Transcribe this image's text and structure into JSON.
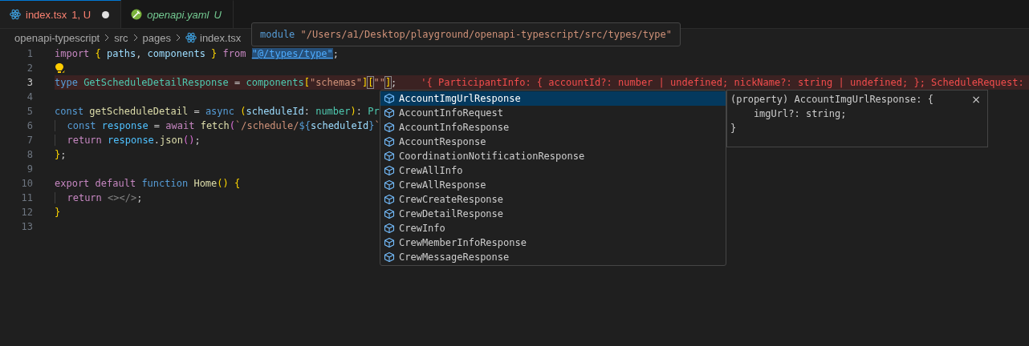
{
  "tabs": [
    {
      "label": "index.tsx",
      "badge": "1, U",
      "kind": "react",
      "selected": true,
      "modified": true,
      "preview": false
    },
    {
      "label": "openapi.yaml",
      "badge": "U",
      "kind": "yaml",
      "selected": false,
      "modified": false,
      "preview": true
    }
  ],
  "breadcrumbs": [
    {
      "label": "openapi-typescript",
      "kind": "folder"
    },
    {
      "label": "src",
      "kind": "folder"
    },
    {
      "label": "pages",
      "kind": "folder"
    },
    {
      "label": "index.tsx",
      "kind": "react"
    }
  ],
  "hover": {
    "tokens": [
      {
        "text": "module ",
        "kind": "kw"
      },
      {
        "text": "\"/Users/a1/Desktop/playground/openapi-typescript/src/types/type\"",
        "kind": "str"
      }
    ]
  },
  "lines": [
    {
      "number": "1",
      "tokens": [
        {
          "text": "import ",
          "kind": "ctrl"
        },
        {
          "text": "{ ",
          "kind": "brace"
        },
        {
          "text": "paths",
          "kind": "var"
        },
        {
          "text": ", ",
          "kind": "punct"
        },
        {
          "text": "components ",
          "kind": "var"
        },
        {
          "text": "} ",
          "kind": "brace"
        },
        {
          "text": "from ",
          "kind": "ctrl"
        },
        {
          "text": "\"@/types/type\"",
          "kind": "link"
        },
        {
          "text": ";",
          "kind": "punct"
        }
      ]
    },
    {
      "number": "2",
      "lightbulb": true
    },
    {
      "number": "3",
      "current": true,
      "error": true,
      "tokens": [
        {
          "text": "type ",
          "kind": "kw"
        },
        {
          "text": "GetScheduleDetailResponse",
          "kind": "type"
        },
        {
          "text": " = ",
          "kind": "punct"
        },
        {
          "text": "components",
          "kind": "type"
        },
        {
          "text": "[",
          "kind": "brace"
        },
        {
          "text": "\"schemas\"",
          "kind": "str"
        },
        {
          "text": "]",
          "kind": "brace"
        },
        {
          "text": "[",
          "kind": "match"
        },
        {
          "text": "\"\"",
          "kind": "str"
        },
        {
          "text": "]",
          "kind": "match"
        },
        {
          "text": ";",
          "kind": "punct"
        }
      ],
      "inline_error": "'{ ParticipantInfo: { accountId?: number | undefined; nickName?: string | undefined; }; ScheduleRequest:"
    },
    {
      "number": "4"
    },
    {
      "number": "5",
      "tokens": [
        {
          "text": "const ",
          "kind": "kw"
        },
        {
          "text": "getScheduleDetail",
          "kind": "fn"
        },
        {
          "text": " = ",
          "kind": "punct"
        },
        {
          "text": "async ",
          "kind": "kw"
        },
        {
          "text": "(",
          "kind": "brace"
        },
        {
          "text": "scheduleId",
          "kind": "var"
        },
        {
          "text": ": ",
          "kind": "punct"
        },
        {
          "text": "number",
          "kind": "type"
        },
        {
          "text": ")",
          "kind": "brace"
        },
        {
          "text": ": ",
          "kind": "punct"
        },
        {
          "text": "Pr",
          "kind": "type"
        }
      ]
    },
    {
      "number": "6",
      "indented": true,
      "tokens": [
        {
          "text": "const ",
          "kind": "kw"
        },
        {
          "text": "response",
          "kind": "const"
        },
        {
          "text": " = ",
          "kind": "punct"
        },
        {
          "text": "await ",
          "kind": "ctrl"
        },
        {
          "text": "fetch",
          "kind": "fn"
        },
        {
          "text": "(",
          "kind": "paren"
        },
        {
          "text": "`/schedule/",
          "kind": "str"
        },
        {
          "text": "${",
          "kind": "kw"
        },
        {
          "text": "scheduleId",
          "kind": "var"
        },
        {
          "text": "}",
          "kind": "kw"
        },
        {
          "text": "`",
          "kind": "str"
        }
      ]
    },
    {
      "number": "7",
      "indented": true,
      "tokens": [
        {
          "text": "return ",
          "kind": "ctrl"
        },
        {
          "text": "response",
          "kind": "const"
        },
        {
          "text": ".",
          "kind": "punct"
        },
        {
          "text": "json",
          "kind": "fn"
        },
        {
          "text": "()",
          "kind": "paren"
        },
        {
          "text": ";",
          "kind": "punct"
        }
      ]
    },
    {
      "number": "8",
      "tokens": [
        {
          "text": "}",
          "kind": "brace"
        },
        {
          "text": ";",
          "kind": "punct"
        }
      ]
    },
    {
      "number": "9"
    },
    {
      "number": "10",
      "tokens": [
        {
          "text": "export ",
          "kind": "ctrl"
        },
        {
          "text": "default ",
          "kind": "ctrl"
        },
        {
          "text": "function ",
          "kind": "kw"
        },
        {
          "text": "Home",
          "kind": "fn"
        },
        {
          "text": "() ",
          "kind": "brace"
        },
        {
          "text": "{",
          "kind": "brace"
        }
      ]
    },
    {
      "number": "11",
      "indented": true,
      "tokens": [
        {
          "text": "return ",
          "kind": "ctrl"
        },
        {
          "text": "<></>",
          "kind": "tag"
        },
        {
          "text": ";",
          "kind": "punct"
        }
      ]
    },
    {
      "number": "12",
      "tokens": [
        {
          "text": "}",
          "kind": "brace"
        }
      ]
    },
    {
      "number": "13"
    }
  ],
  "suggestions": {
    "items": [
      {
        "label": "AccountImgUrlResponse",
        "selected": true
      },
      {
        "label": "AccountInfoRequest",
        "selected": false
      },
      {
        "label": "AccountInfoResponse",
        "selected": false
      },
      {
        "label": "AccountResponse",
        "selected": false
      },
      {
        "label": "CoordinationNotificationResponse",
        "selected": false
      },
      {
        "label": "CrewAllInfo",
        "selected": false
      },
      {
        "label": "CrewAllResponse",
        "selected": false
      },
      {
        "label": "CrewCreateResponse",
        "selected": false
      },
      {
        "label": "CrewDetailResponse",
        "selected": false
      },
      {
        "label": "CrewInfo",
        "selected": false
      },
      {
        "label": "CrewMemberInfoResponse",
        "selected": false
      },
      {
        "label": "CrewMessageResponse",
        "selected": false
      }
    ],
    "detail": {
      "lines": [
        "(property) AccountImgUrlResponse: {",
        "    imgUrl?: string;",
        "}"
      ],
      "close": "×"
    }
  }
}
